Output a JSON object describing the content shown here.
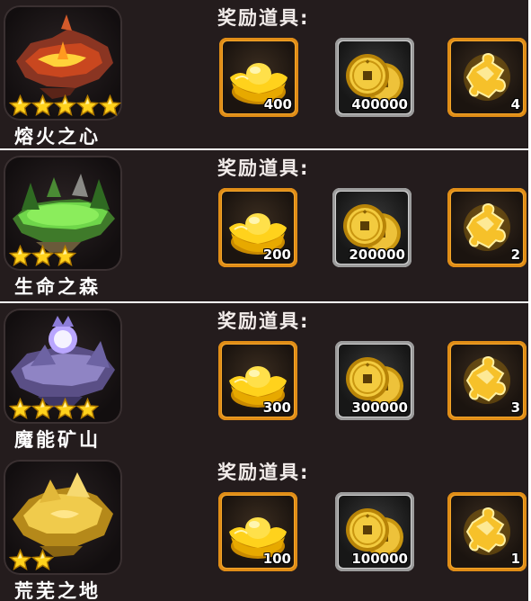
{
  "reward_title": "奖励道具:",
  "icons": {
    "gold_ingot": "gold-ingot-icon",
    "coins": "copper-coins-icon",
    "fragment": "puzzle-fragment-icon",
    "star": "star-icon"
  },
  "colors": {
    "row_bg": "#241c1d",
    "slot_orange": "#f4a62a",
    "slot_gray": "#cfcfcf",
    "gold": "#f7c81c"
  },
  "areas": [
    {
      "name": "熔火之心",
      "stars": 5,
      "theme": "lava",
      "rewards": {
        "ingot": "400",
        "coins": "400000",
        "fragment": "4"
      }
    },
    {
      "name": "生命之森",
      "stars": 3,
      "theme": "forest",
      "rewards": {
        "ingot": "200",
        "coins": "200000",
        "fragment": "2"
      }
    },
    {
      "name": "魔能矿山",
      "stars": 4,
      "theme": "crystal",
      "rewards": {
        "ingot": "300",
        "coins": "300000",
        "fragment": "3"
      }
    },
    {
      "name": "荒芜之地",
      "stars": 2,
      "theme": "desert",
      "rewards": {
        "ingot": "100",
        "coins": "100000",
        "fragment": "1"
      }
    }
  ]
}
